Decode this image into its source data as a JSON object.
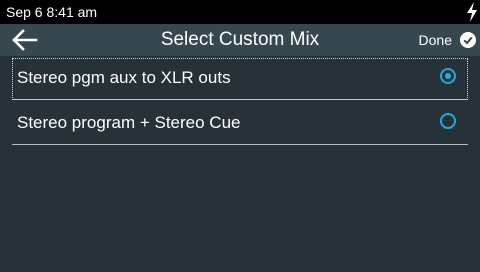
{
  "status_bar": {
    "time": "Sep 6 8:41 am",
    "charging_icon": "bolt-icon"
  },
  "header": {
    "back_icon": "arrow-left-icon",
    "title": "Select Custom Mix",
    "done_label": "Done",
    "done_icon": "check-circle-icon"
  },
  "options": [
    {
      "label": "Stereo pgm aux to XLR outs",
      "selected": true
    },
    {
      "label": "Stereo program + Stereo Cue",
      "selected": false
    }
  ],
  "colors": {
    "background": "#263238",
    "app_bar": "#37474f",
    "accent": "#29a8e0",
    "status_bar": "#000000"
  }
}
